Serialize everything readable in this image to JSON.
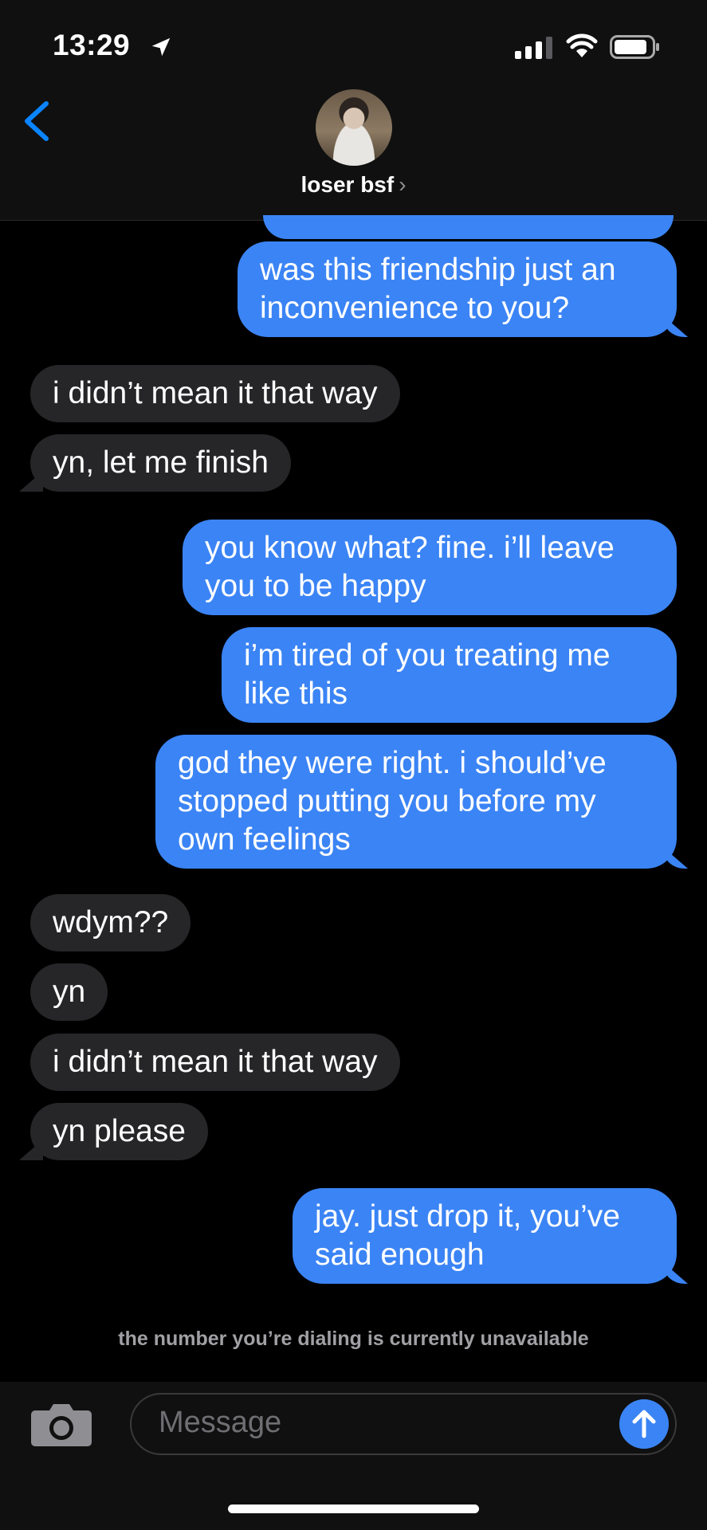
{
  "status": {
    "time": "13:29"
  },
  "contact": {
    "name": "loser bsf",
    "chevron": "›"
  },
  "messages": [
    {
      "side": "sent",
      "text": "was this friendship just an inconvenience to you?"
    },
    {
      "side": "recv",
      "text": "i didn’t mean it that way"
    },
    {
      "side": "recv",
      "text": "yn, let me finish"
    },
    {
      "side": "sent",
      "text": "you know what? fine. i’ll leave you to be happy"
    },
    {
      "side": "sent",
      "text": "i’m tired of you treating me like this"
    },
    {
      "side": "sent",
      "text": "god they were right. i should’ve stopped putting you before my own feelings"
    },
    {
      "side": "recv",
      "text": "wdym??"
    },
    {
      "side": "recv",
      "text": "yn"
    },
    {
      "side": "recv",
      "text": "i didn’t mean it that way"
    },
    {
      "side": "recv",
      "text": "yn please"
    },
    {
      "side": "sent",
      "text": "jay. just drop it, you’ve said enough"
    }
  ],
  "notice": "the number you’re dialing is currently unavailable",
  "input": {
    "placeholder": "Message"
  },
  "icons": [
    "location-arrow-icon",
    "signal-icon",
    "wifi-icon",
    "battery-icon",
    "back-chevron-icon",
    "camera-icon",
    "send-arrow-icon"
  ],
  "colors": {
    "sent_bubble": "#3b84f5",
    "recv_bubble": "#262628",
    "accent": "#0a84ff"
  }
}
